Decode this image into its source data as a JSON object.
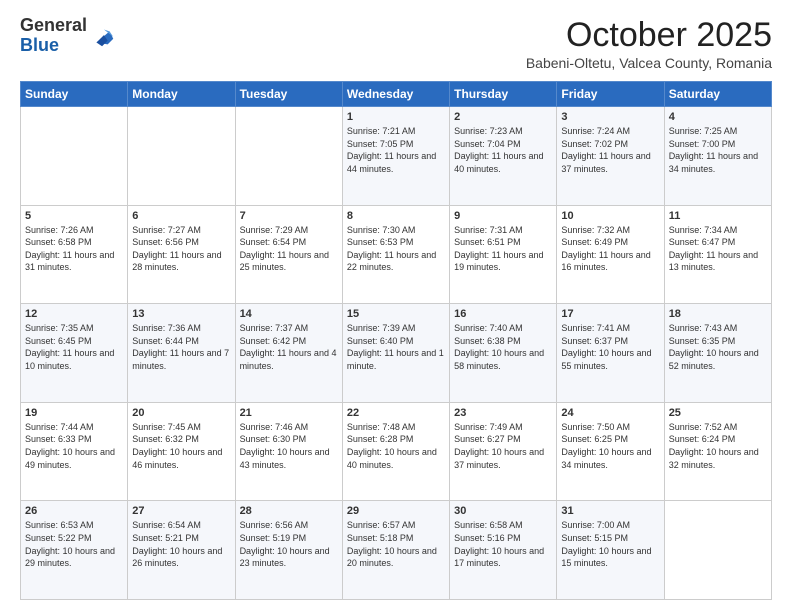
{
  "header": {
    "logo_general": "General",
    "logo_blue": "Blue",
    "month": "October 2025",
    "location": "Babeni-Oltetu, Valcea County, Romania"
  },
  "days_of_week": [
    "Sunday",
    "Monday",
    "Tuesday",
    "Wednesday",
    "Thursday",
    "Friday",
    "Saturday"
  ],
  "weeks": [
    [
      {
        "day": "",
        "info": ""
      },
      {
        "day": "",
        "info": ""
      },
      {
        "day": "",
        "info": ""
      },
      {
        "day": "1",
        "info": "Sunrise: 7:21 AM\nSunset: 7:05 PM\nDaylight: 11 hours\nand 44 minutes."
      },
      {
        "day": "2",
        "info": "Sunrise: 7:23 AM\nSunset: 7:04 PM\nDaylight: 11 hours\nand 40 minutes."
      },
      {
        "day": "3",
        "info": "Sunrise: 7:24 AM\nSunset: 7:02 PM\nDaylight: 11 hours\nand 37 minutes."
      },
      {
        "day": "4",
        "info": "Sunrise: 7:25 AM\nSunset: 7:00 PM\nDaylight: 11 hours\nand 34 minutes."
      }
    ],
    [
      {
        "day": "5",
        "info": "Sunrise: 7:26 AM\nSunset: 6:58 PM\nDaylight: 11 hours\nand 31 minutes."
      },
      {
        "day": "6",
        "info": "Sunrise: 7:27 AM\nSunset: 6:56 PM\nDaylight: 11 hours\nand 28 minutes."
      },
      {
        "day": "7",
        "info": "Sunrise: 7:29 AM\nSunset: 6:54 PM\nDaylight: 11 hours\nand 25 minutes."
      },
      {
        "day": "8",
        "info": "Sunrise: 7:30 AM\nSunset: 6:53 PM\nDaylight: 11 hours\nand 22 minutes."
      },
      {
        "day": "9",
        "info": "Sunrise: 7:31 AM\nSunset: 6:51 PM\nDaylight: 11 hours\nand 19 minutes."
      },
      {
        "day": "10",
        "info": "Sunrise: 7:32 AM\nSunset: 6:49 PM\nDaylight: 11 hours\nand 16 minutes."
      },
      {
        "day": "11",
        "info": "Sunrise: 7:34 AM\nSunset: 6:47 PM\nDaylight: 11 hours\nand 13 minutes."
      }
    ],
    [
      {
        "day": "12",
        "info": "Sunrise: 7:35 AM\nSunset: 6:45 PM\nDaylight: 11 hours\nand 10 minutes."
      },
      {
        "day": "13",
        "info": "Sunrise: 7:36 AM\nSunset: 6:44 PM\nDaylight: 11 hours\nand 7 minutes."
      },
      {
        "day": "14",
        "info": "Sunrise: 7:37 AM\nSunset: 6:42 PM\nDaylight: 11 hours\nand 4 minutes."
      },
      {
        "day": "15",
        "info": "Sunrise: 7:39 AM\nSunset: 6:40 PM\nDaylight: 11 hours\nand 1 minute."
      },
      {
        "day": "16",
        "info": "Sunrise: 7:40 AM\nSunset: 6:38 PM\nDaylight: 10 hours\nand 58 minutes."
      },
      {
        "day": "17",
        "info": "Sunrise: 7:41 AM\nSunset: 6:37 PM\nDaylight: 10 hours\nand 55 minutes."
      },
      {
        "day": "18",
        "info": "Sunrise: 7:43 AM\nSunset: 6:35 PM\nDaylight: 10 hours\nand 52 minutes."
      }
    ],
    [
      {
        "day": "19",
        "info": "Sunrise: 7:44 AM\nSunset: 6:33 PM\nDaylight: 10 hours\nand 49 minutes."
      },
      {
        "day": "20",
        "info": "Sunrise: 7:45 AM\nSunset: 6:32 PM\nDaylight: 10 hours\nand 46 minutes."
      },
      {
        "day": "21",
        "info": "Sunrise: 7:46 AM\nSunset: 6:30 PM\nDaylight: 10 hours\nand 43 minutes."
      },
      {
        "day": "22",
        "info": "Sunrise: 7:48 AM\nSunset: 6:28 PM\nDaylight: 10 hours\nand 40 minutes."
      },
      {
        "day": "23",
        "info": "Sunrise: 7:49 AM\nSunset: 6:27 PM\nDaylight: 10 hours\nand 37 minutes."
      },
      {
        "day": "24",
        "info": "Sunrise: 7:50 AM\nSunset: 6:25 PM\nDaylight: 10 hours\nand 34 minutes."
      },
      {
        "day": "25",
        "info": "Sunrise: 7:52 AM\nSunset: 6:24 PM\nDaylight: 10 hours\nand 32 minutes."
      }
    ],
    [
      {
        "day": "26",
        "info": "Sunrise: 6:53 AM\nSunset: 5:22 PM\nDaylight: 10 hours\nand 29 minutes."
      },
      {
        "day": "27",
        "info": "Sunrise: 6:54 AM\nSunset: 5:21 PM\nDaylight: 10 hours\nand 26 minutes."
      },
      {
        "day": "28",
        "info": "Sunrise: 6:56 AM\nSunset: 5:19 PM\nDaylight: 10 hours\nand 23 minutes."
      },
      {
        "day": "29",
        "info": "Sunrise: 6:57 AM\nSunset: 5:18 PM\nDaylight: 10 hours\nand 20 minutes."
      },
      {
        "day": "30",
        "info": "Sunrise: 6:58 AM\nSunset: 5:16 PM\nDaylight: 10 hours\nand 17 minutes."
      },
      {
        "day": "31",
        "info": "Sunrise: 7:00 AM\nSunset: 5:15 PM\nDaylight: 10 hours\nand 15 minutes."
      },
      {
        "day": "",
        "info": ""
      }
    ]
  ]
}
